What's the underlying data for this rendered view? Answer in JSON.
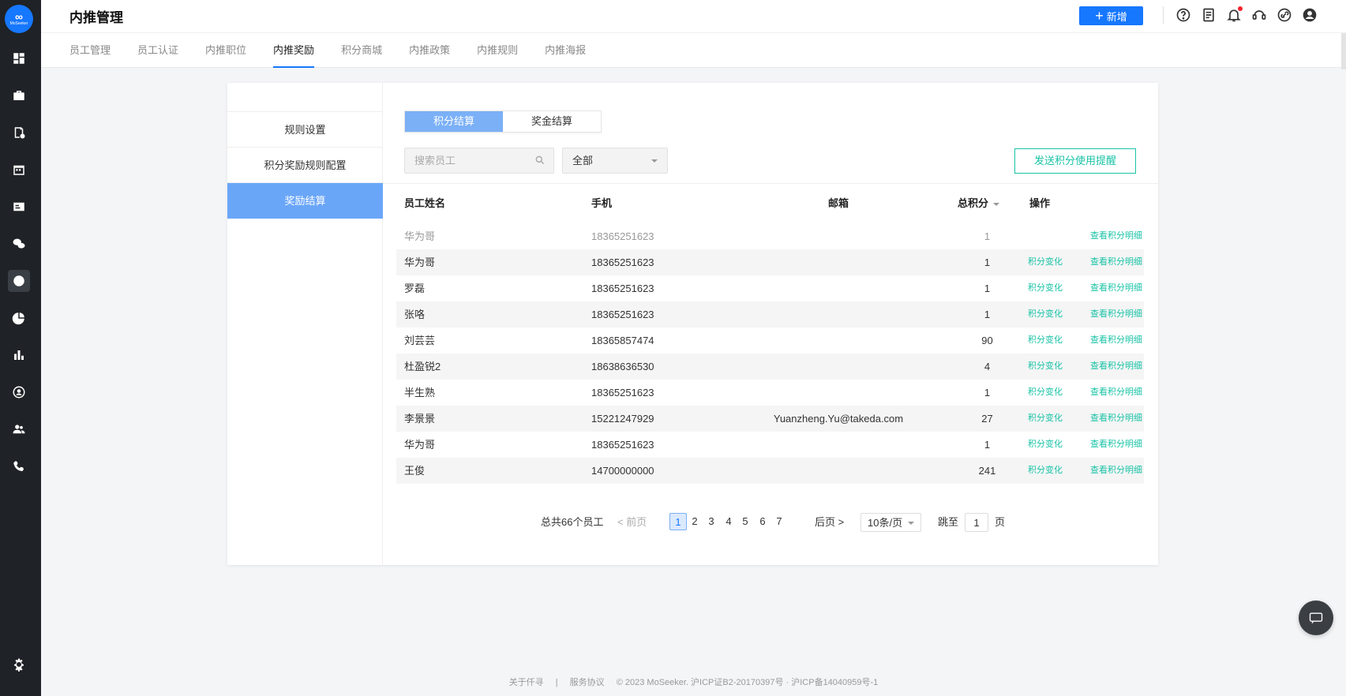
{
  "brand": {
    "logo_word": "MoSeeker",
    "accent": "#1677ff",
    "link_color": "#19c3a6"
  },
  "header": {
    "title": "内推管理",
    "add_label": "新增",
    "icons": [
      "help-icon",
      "document-icon",
      "bell-icon",
      "support-icon",
      "link-icon",
      "user-icon"
    ]
  },
  "tabs": [
    {
      "label": "员工管理"
    },
    {
      "label": "员工认证"
    },
    {
      "label": "内推职位"
    },
    {
      "label": "内推奖励",
      "active": true
    },
    {
      "label": "积分商城"
    },
    {
      "label": "内推政策"
    },
    {
      "label": "内推规则"
    },
    {
      "label": "内推海报"
    }
  ],
  "sidenav": [
    {
      "label": "规则设置"
    },
    {
      "label": "积分奖励规则配置"
    },
    {
      "label": "奖励结算",
      "active": true
    }
  ],
  "segment": {
    "points": "积分结算",
    "bonus": "奖金结算"
  },
  "filters": {
    "search_placeholder": "搜索员工",
    "select_value": "全部",
    "remind_label": "发送积分使用提醒"
  },
  "table": {
    "headers": {
      "name": "员工姓名",
      "phone": "手机",
      "email": "邮箱",
      "score": "总积分",
      "op": "操作"
    },
    "change_label": "积分变化",
    "detail_label": "查看积分明细",
    "rows": [
      {
        "name": "华为哥",
        "phone": "18365251623",
        "email": "",
        "score": "1",
        "dim": true
      },
      {
        "name": "华为哥",
        "phone": "18365251623",
        "email": "",
        "score": "1"
      },
      {
        "name": "罗磊",
        "phone": "18365251623",
        "email": "",
        "score": "1"
      },
      {
        "name": "张咯",
        "phone": "18365251623",
        "email": "",
        "score": "1"
      },
      {
        "name": "刘芸芸",
        "phone": "18365857474",
        "email": "",
        "score": "90"
      },
      {
        "name": "杜盈锐2",
        "phone": "18638636530",
        "email": "",
        "score": "4"
      },
      {
        "name": "半生熟",
        "phone": "18365251623",
        "email": "",
        "score": "1"
      },
      {
        "name": "李景景",
        "phone": "15221247929",
        "email": "Yuanzheng.Yu@takeda.com",
        "score": "27"
      },
      {
        "name": "华为哥",
        "phone": "18365251623",
        "email": "",
        "score": "1"
      },
      {
        "name": "王俊",
        "phone": "14700000000",
        "email": "",
        "score": "241"
      }
    ]
  },
  "pagination": {
    "total": "总共66个员工",
    "prev": "< 前页",
    "pages": [
      "1",
      "2",
      "3",
      "4",
      "5",
      "6",
      "7"
    ],
    "current": "1",
    "next": "后页 >",
    "page_size": "10条/页",
    "jump_label": "跳至",
    "jump_value": "1",
    "jump_unit": "页"
  },
  "footer": {
    "about": "关于仟寻",
    "sep": "|",
    "terms": "服务协议",
    "copyright": "© 2023 MoSeeker. 沪ICP证B2-20170397号 · 沪ICP备14040959号-1"
  }
}
